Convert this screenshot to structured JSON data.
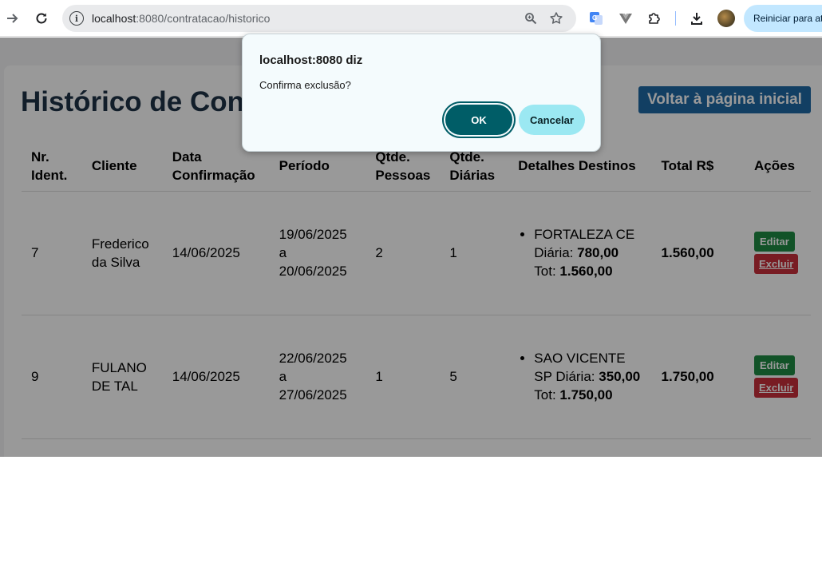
{
  "browser": {
    "url_host": "localhost",
    "url_path": ":8080/contratacao/historico",
    "restart_label": "Reiniciar para atualizar"
  },
  "page": {
    "title": "Histórico de Contratações",
    "home_button": "Voltar à página inicial",
    "columns": {
      "id_line1": "Nr.",
      "id_line2": "Ident.",
      "client": "Cliente",
      "date_line1": "Data",
      "date_line2": "Confirmação",
      "period": "Período",
      "people_line1": "Qtde.",
      "people_line2": "Pessoas",
      "days_line1": "Qtde.",
      "days_line2": "Diárias",
      "details": "Detalhes Destinos",
      "total": "Total R$",
      "actions": "Ações"
    },
    "rows": [
      {
        "id": "7",
        "client": "Frederico da Silva",
        "confirmed": "14/06/2025",
        "period_start": "19/06/2025",
        "period_sep": "a",
        "period_end": "20/06/2025",
        "people": "2",
        "days": "1",
        "destination": "FORTALEZA CE",
        "daily_label": "Diária:",
        "daily_value": "780,00",
        "tot_label": "Tot:",
        "tot_value": "1.560,00",
        "total": "1.560,00",
        "edit": "Editar",
        "delete": "Excluir"
      },
      {
        "id": "9",
        "client": "FULANO DE TAL",
        "confirmed": "14/06/2025",
        "period_start": "22/06/2025",
        "period_sep": "a",
        "period_end": "27/06/2025",
        "people": "1",
        "days": "5",
        "destination": "SAO VICENTE SP",
        "daily_label": "Diária:",
        "daily_value": "350,00",
        "tot_label": "Tot:",
        "tot_value": "1.750,00",
        "total": "1.750,00",
        "edit": "Editar",
        "delete": "Excluir"
      }
    ]
  },
  "dialog": {
    "title": "localhost:8080 diz",
    "message": "Confirma exclusão?",
    "ok": "OK",
    "cancel": "Cancelar"
  }
}
